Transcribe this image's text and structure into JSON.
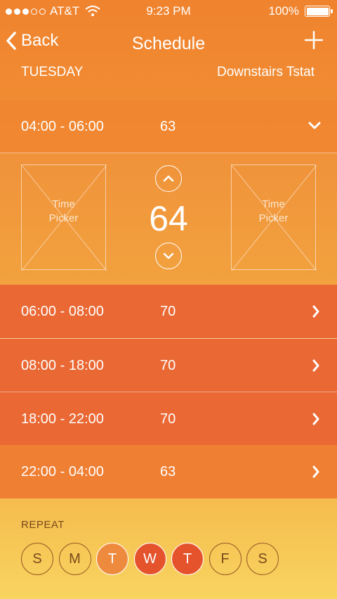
{
  "status": {
    "carrier": "AT&T",
    "time": "9:23 PM",
    "battery": "100%"
  },
  "nav": {
    "back_label": "Back",
    "title": "Schedule"
  },
  "subheader": {
    "day": "TUESDAY",
    "device": "Downstairs Tstat"
  },
  "expanded": {
    "range": "04:00 - 06:00",
    "temp": "63",
    "current_temp": "64",
    "picker_left": "Time\nPicker",
    "picker_right": "Time\nPicker"
  },
  "schedule": [
    {
      "range": "06:00 - 08:00",
      "temp": "70"
    },
    {
      "range": "08:00 - 18:00",
      "temp": "70"
    },
    {
      "range": "18:00 - 22:00",
      "temp": "70"
    },
    {
      "range": "22:00 - 04:00",
      "temp": "63"
    }
  ],
  "repeat": {
    "label": "REPEAT",
    "days": [
      {
        "letter": "S",
        "state": "off"
      },
      {
        "letter": "M",
        "state": "off"
      },
      {
        "letter": "T",
        "state": "on-light"
      },
      {
        "letter": "W",
        "state": "on-dark"
      },
      {
        "letter": "T",
        "state": "on-dark"
      },
      {
        "letter": "F",
        "state": "off"
      },
      {
        "letter": "S",
        "state": "off"
      }
    ]
  },
  "colors": {
    "dark_row": "#ea6834",
    "mid_row": "#ee7f33",
    "selected_day": "#e5532d"
  }
}
